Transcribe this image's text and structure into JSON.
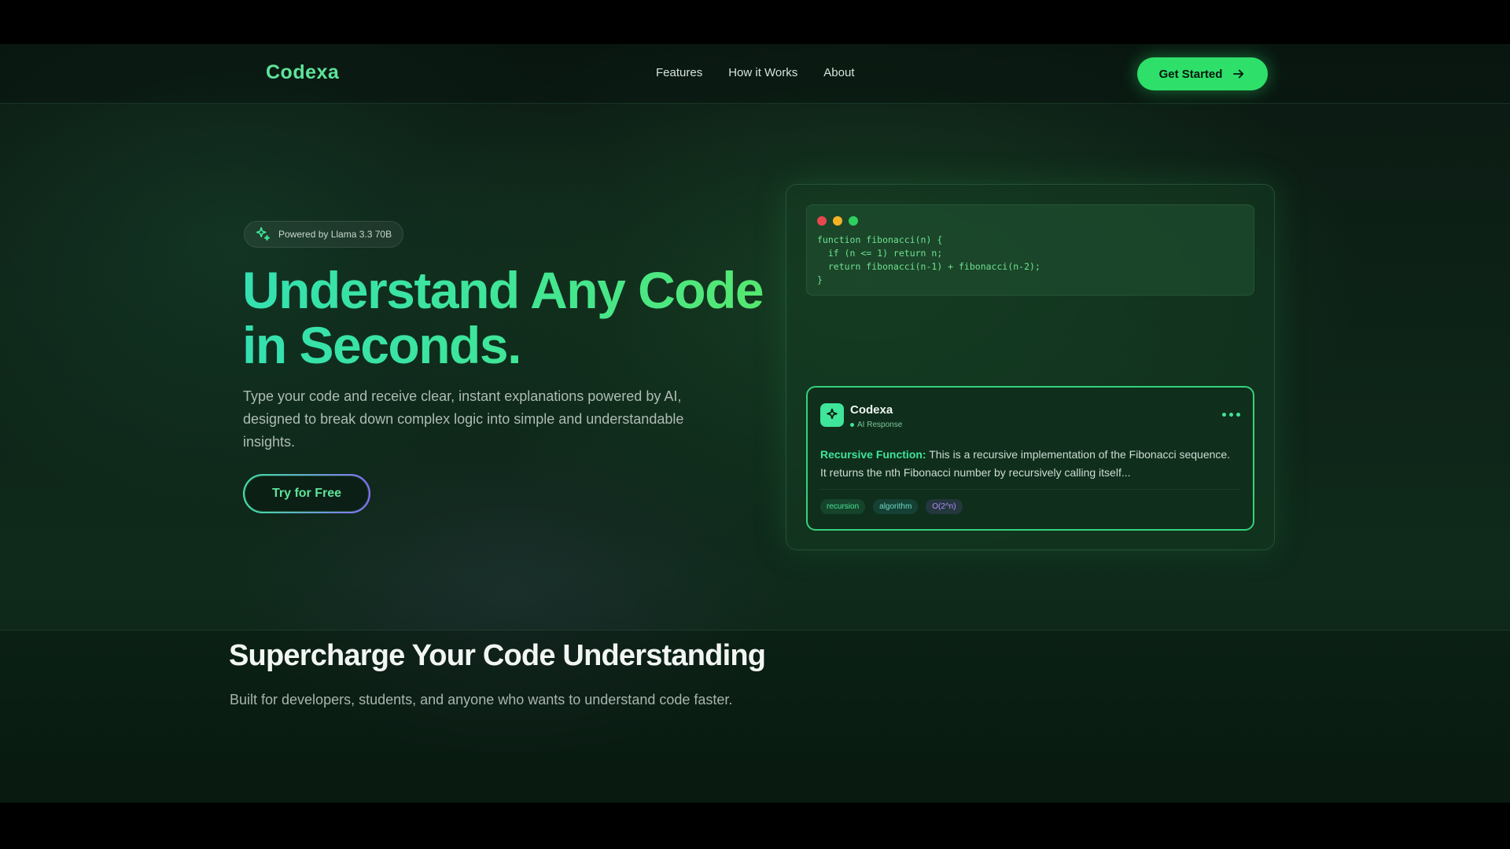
{
  "nav": {
    "logo": "Codexa",
    "links": [
      "Features",
      "How it Works",
      "About"
    ],
    "cta_label": "Get Started"
  },
  "hero": {
    "badge": "Powered by Llama 3.3 70B",
    "title_line1": "Understand Any Code",
    "title_line2": "in Seconds.",
    "description": "Type your code and receive clear, instant explanations powered by AI, designed to break down complex logic into simple and understandable insights.",
    "cta_label": "Try for Free"
  },
  "mock": {
    "window_dots": [
      "#e5484d",
      "#f5b324",
      "#2ed15e"
    ],
    "code": "function fibonacci(n) {\n  if (n <= 1) return n;\n  return fibonacci(n-1) + fibonacci(n-2);\n}",
    "response": {
      "name": "Codexa",
      "subtitle": "AI Response",
      "label": "Recursive Function:",
      "text": "This is a recursive implementation of the Fibonacci sequence. It returns the nth Fibonacci number by recursively calling itself...",
      "tags": [
        "recursion",
        "algorithm",
        "O(2^n)"
      ]
    }
  },
  "section2": {
    "title": "Supercharge Your Code Understanding",
    "subtitle": "Built for developers, students, and anyone who wants to understand code faster."
  },
  "colors": {
    "accent": "#2ee06a",
    "background": "#0d2317"
  }
}
